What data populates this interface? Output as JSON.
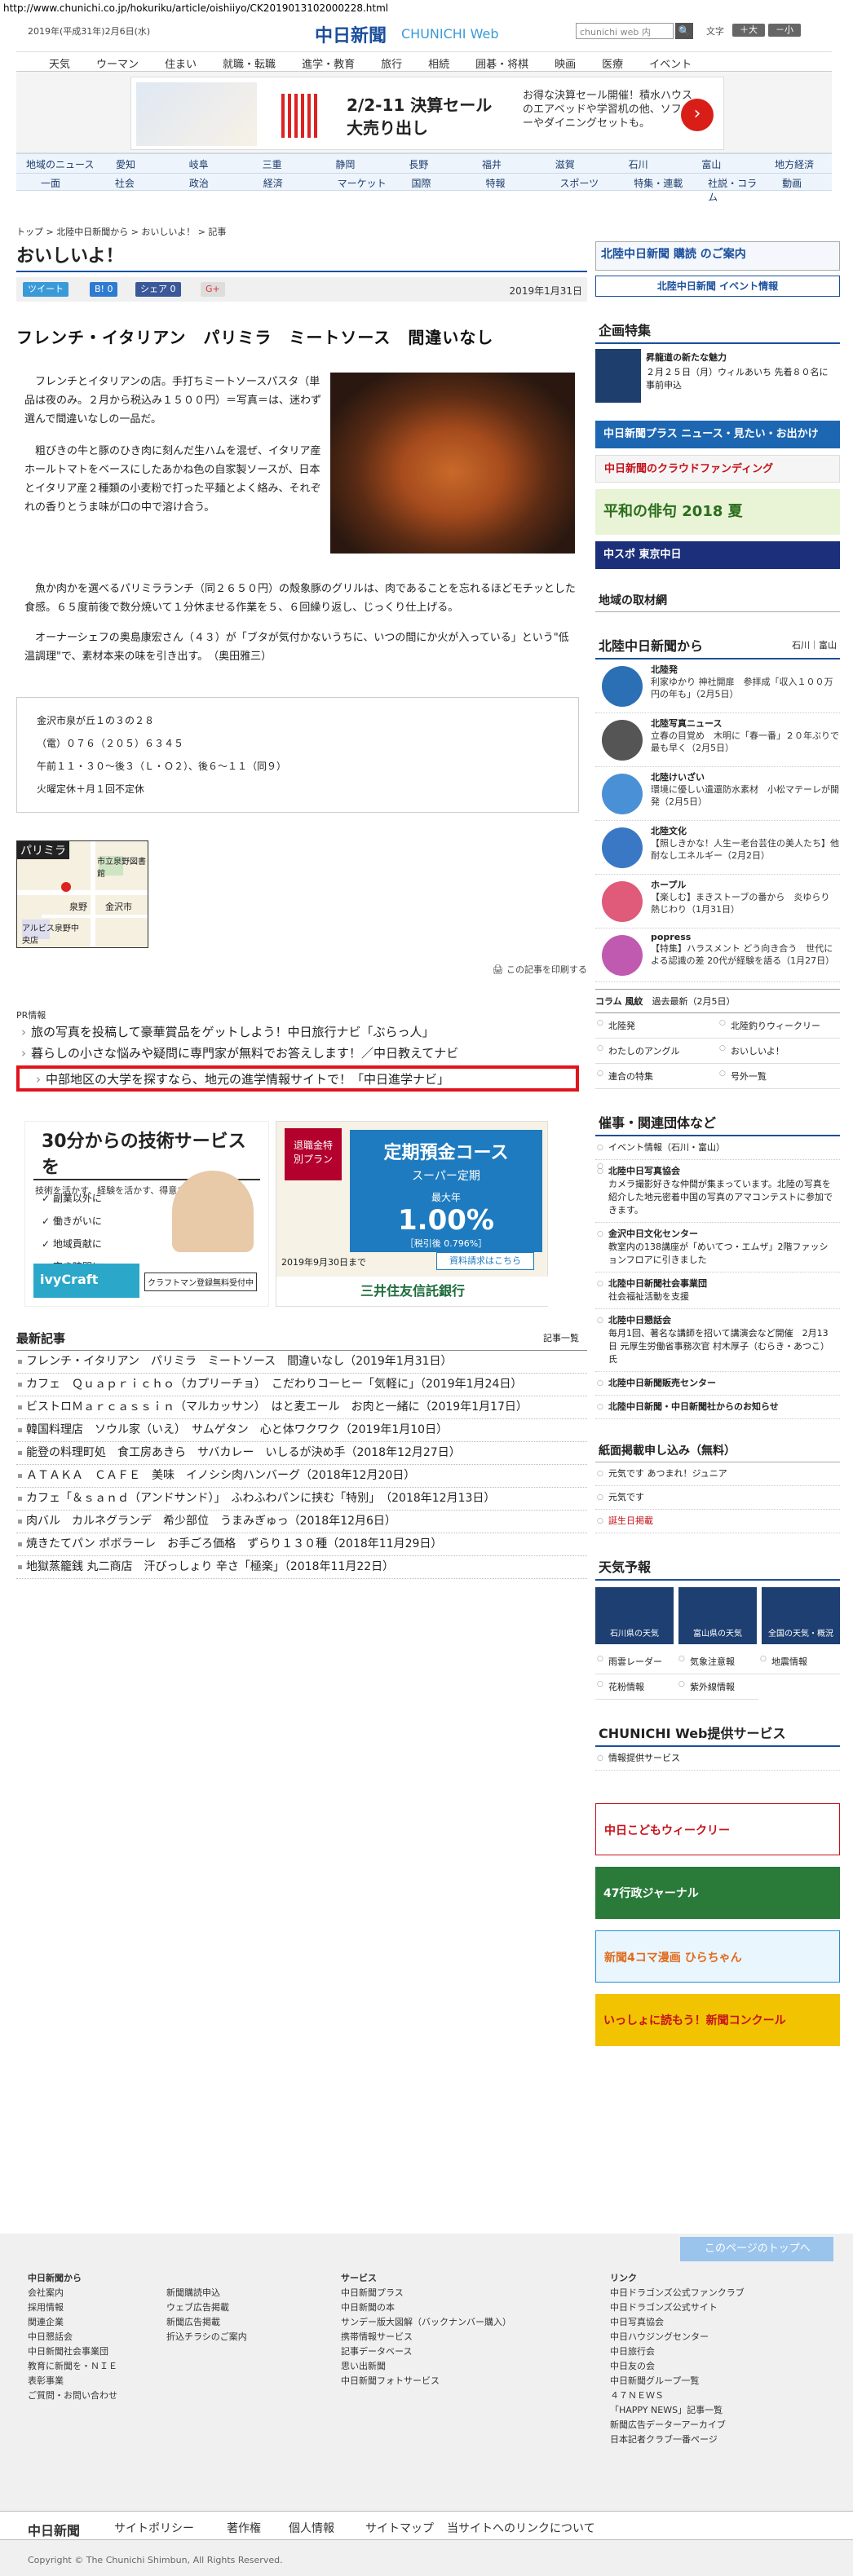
{
  "url": "http://www.chunichi.co.jp/hokuriku/article/oishiiyo/CK2019013102000228.html",
  "header": {
    "date": "2019年(平成31年)2月6日(水)",
    "logo": "中日新聞",
    "logo_sub": "CHUNICHI Web",
    "search_placeholder": "chunichi web 内",
    "search_btn": "🔍",
    "font_label": "文字",
    "font_big": "＋大",
    "font_small": "－小"
  },
  "topnav": [
    "天気",
    "ウーマン",
    "住まい",
    "就職・転職",
    "進学・教育",
    "旅行",
    "相続",
    "囲碁・将棋",
    "映画",
    "医療",
    "イベント"
  ],
  "ad_top": {
    "line1": "2/2-11 決算セール",
    "line2": "大売り出し",
    "desc": "お得な決算セール開催！積水ハウスのエアベッドや学習机の他、ソファーやダイニングセットも。",
    "go": "›"
  },
  "areanav": [
    "地域のニュース",
    "愛知",
    "岐阜",
    "三重",
    "静岡",
    "長野",
    "福井",
    "滋賀",
    "石川",
    "富山",
    "地方経済"
  ],
  "catnav": [
    "一面",
    "社会",
    "政治",
    "経済",
    "マーケット",
    "国際",
    "特報",
    "スポーツ",
    "特集・連載",
    "社説・コラム",
    "動画"
  ],
  "crumb": "トップ > 北陸中日新聞から > おいしいよ！ > 記事",
  "section_title": "おいしいよ！",
  "share": {
    "tweet": "ツイート",
    "hatena": "B! 0",
    "fb": "シェア 0",
    "gplus": "G+",
    "date": "2019年1月31日"
  },
  "article": {
    "headline": "フレンチ・イタリアン　パリミラ　ミートソース　間違いなし",
    "p1": "フレンチとイタリアンの店。手打ちミートソースパスタ（単品は夜のみ。２月から税込み１５００円）＝写真＝は、迷わず選んで間違いなしの一品だ。",
    "p2": "粗びきの牛と豚のひき肉に刻んだ生ハムを混ぜ、イタリア産ホールトマトをベースにしたあかね色の自家製ソースが、日本とイタリア産２種類の小麦粉で打った平麺とよく絡み、それぞれの香りとうま味が口の中で溶け合う。",
    "p3": "魚か肉かを選べるパリミラランチ（同２６５０円）の殻象豚のグリルは、肉であることを忘れるほどモチッとした食感。６５度前後で数分焼いて１分休ませる作業を５、６回繰り返し、じっくり仕上げる。",
    "p4": "オーナーシェフの奥島康宏さん（４３）が「ブタが気付かないうちに、いつの間にか火が入っている」という\"低温調理\"で、素材本来の味を引き出す。　（奥田雅三）"
  },
  "info": {
    "addr": "金沢市泉が丘１の３の２８",
    "tel": "（電）０７６（２０５）６３４５",
    "hours": "午前１１・３０〜後３（Ｌ・Ｏ２）、後６〜１１（同９）",
    "closed": "火曜定休＋月１回不定休"
  },
  "map": {
    "label": "パリミラ",
    "spots": [
      "市立泉野図書館",
      "泉野",
      "金沢市",
      "アルビス泉野中央店"
    ]
  },
  "print_label": "この記事を印刷する",
  "pr": {
    "head": "PR情報",
    "items": [
      "旅の写真を投稿して豪華賞品をゲットしよう！中日旅行ナビ「ぶらっ人」",
      "暮らしの小さな悩みや疑問に専門家が無料でお答えします！／中日教えてナビ",
      "中部地区の大学を探すなら、地元の進学情報サイトで！「中日進学ナビ」"
    ]
  },
  "ad_mid": {
    "a_title": "30分からの技術サービスを",
    "a_sub": "技術を活かす、経験を活かす、得意を活かす",
    "a_points": [
      "副業以外に",
      "働きがいに",
      "地域貢献に",
      "空き時間に"
    ],
    "a_brand": "ivyCraft",
    "a_brand2": "クラフトマン登録無料受付中",
    "b_tag": "退職金特別プラン",
    "b_title": "定期預金コース",
    "b_sub": "スーパー定期",
    "b_rate_label": "最大年",
    "b_rate": "1.00%",
    "b_tax": "［税引後 0.796%］",
    "b_date": "2019年9月30日まで",
    "b_btn": "資料請求はこちら",
    "b_bank": "三井住友信託銀行"
  },
  "latest": {
    "head": "最新記事",
    "more": "記事一覧",
    "items": [
      "フレンチ・イタリアン　パリミラ　ミートソース　間違いなし（2019年1月31日）",
      "カフェ　Ｑｕａｐｒｉｃｈｏ（カプリーチョ）　こだわりコーヒー「気軽に」（2019年1月24日）",
      "ビストロＭａｒｃａｓｓｉｎ（マルカッサン）　はと麦エール　お肉と一緒に（2019年1月17日）",
      "韓国料理店　ソウル家（いえ）　サムゲタン　心と体ワクワク（2019年1月10日）",
      "能登の料理町処　食工房あきら　サバカレー　いしるが決め手（2018年12月27日）",
      "ＡＴＡＫＡ　ＣＡＦＥ　美味　イノシシ肉ハンバーグ（2018年12月20日）",
      "カフェ「＆ｓａｎｄ（アンドサンド）」　ふわふわパンに挟む「特別」　（2018年12月13日）",
      "肉バル　カルネグランデ　希少部位　うまみぎゅっ（2018年12月6日）",
      "焼きたてパン ポボラーレ　お手ごろ価格　ずらり１３０種（2018年11月29日）",
      "地獄蒸籠銭 丸二商店　汗びっしょり 辛さ「極楽」（2018年11月22日）"
    ]
  },
  "side": {
    "subscribe": "北陸中日新聞 購読 のご案内",
    "events": "北陸中日新聞 イベント情報",
    "kikaku_head": "企画特集",
    "kikaku_title": "昇龍道の新たな魅力",
    "kikaku_text": "２月２５日（月）ウィルあいち 先着８０名に事前申込",
    "banners": [
      "中日新聞プラス ニュース・見たい・お出かけ",
      "中日新聞のクラウドファンディング",
      "平和の俳句 2018 夏",
      "中スポ 東京中日"
    ],
    "area_head": "地域の取材網",
    "hokuriku_head": "北陸中日新聞から",
    "hokuriku_links": "石川｜富山",
    "news": [
      {
        "t": "北陸発",
        "d": "利家ゆかり 神社開扉　参拝成「収入１００万円の年も」（2月5日）",
        "c": "#2b6fb5"
      },
      {
        "t": "北陸写真ニュース",
        "d": "立春の目覚め　木明に「春一番」２０年ぶりで最も早く（2月5日）",
        "c": "#555"
      },
      {
        "t": "北陸けいざい",
        "d": "環境に優しい遺還防水素材　小松マテーレが開発（2月5日）",
        "c": "#4a90d6"
      },
      {
        "t": "北陸文化",
        "d": "【照しきかな！人生ー老台芸住の美人たち】他耐なしエネルギー（2月2日）",
        "c": "#3a78c6"
      },
      {
        "t": "ホープル",
        "d": "【楽しむ】まきストーブの番から　炎ゆらり 熱じわり（1月31日）",
        "c": "#e05a7a"
      },
      {
        "t": "popress",
        "d": "【特集】ハラスメント どう向き合う　世代による認識の差 20代が経験を語る（1月27日）",
        "c": "#c05ab0"
      }
    ],
    "column_head": "コラム 風紋",
    "column_link": "過去最新（2月5日）",
    "grid": [
      "北陸発",
      "北陸釣りウィークリー",
      "わたしのアングル",
      "おいしいよ！",
      "連合の特集",
      "号外一覧"
    ],
    "sponsor_head": "催事・関連団体など",
    "event_info": "イベント情報（石川・富山）",
    "sponsors": [
      {
        "t": "北陸中日写真協会",
        "d": "カメラ撮影好きな仲間が集まっています。北陸の写真を紹介した地元密着中国の写真のアマコンテストに参加できます。"
      },
      {
        "t": "金沢中日文化センター",
        "d": "教室内の138講座が「めいてつ・エムザ」2階ファッションフロアに引きました"
      },
      {
        "t": "北陸中日新聞社会事業団",
        "d": "社会福祉活動を支援"
      },
      {
        "t": "北陸中日懇話会",
        "d": "毎月1回、著名な講師を招いて講演会など開催　2月13日 元厚生労働省事務次官 村木厚子（むらき・あつこ）氏"
      },
      {
        "t": "北陸中日新聞販売センター",
        "d": ""
      },
      {
        "t": "北陸中日新聞・中日新聞社からのお知らせ",
        "d": ""
      }
    ],
    "paper_head": "紙面掲載申し込み（無料）",
    "paper_items": [
      "元気です あつまれ！ジュニア",
      "元気です",
      "誕生日掲載"
    ],
    "weather_head": "天気予報",
    "weather": [
      "石川県の天気",
      "富山県の天気",
      "全国の天気・概況"
    ],
    "weather_links": [
      "雨雲レーダー",
      "気象注意報",
      "地震情報",
      "花粉情報",
      "紫外線情報"
    ],
    "service_head": "CHUNICHI Web提供サービス",
    "service_link": "情報提供サービス",
    "b2": [
      "中日こどもウィークリー",
      "47行政ジャーナル",
      "新聞4コマ漫画 ひらちゃん",
      "いっしょに読もう！新聞コンクール"
    ]
  },
  "footer": {
    "top": "このページのトップへ",
    "col1_head": "中日新聞から",
    "col1": [
      "会社案内",
      "採用情報",
      "関連企業",
      "中日懇話会",
      "中日新聞社会事業団",
      "教育に新聞を・ＮＩＥ",
      "表彰事業",
      "ご質問・お問い合わせ"
    ],
    "col2": [
      "新聞購読申込",
      "ウェブ広告掲載",
      "新聞広告掲載",
      "折込チラシのご案内"
    ],
    "col3_head": "サービス",
    "col3": [
      "中日新聞プラス",
      "中日新聞の本",
      "サンデー版大図解（バックナンバー購入）",
      "携帯情報サービス",
      "記事データベース",
      "思い出新聞",
      "中日新聞フォトサービス"
    ],
    "col4_head": "リンク",
    "col4": [
      "中日ドラゴンズ公式ファンクラブ",
      "中日ドラゴンズ公式サイト",
      "中日写真協会",
      "中日ハウジングセンター",
      "中日旅行会",
      "中日友の会",
      "中日新聞グループ一覧",
      "４７ＮＥＷＳ",
      "「HAPPY NEWS」記事一覧",
      "新聞広告データーアーカイブ",
      "日本記者クラブ一番ページ"
    ],
    "bar": [
      "中日新聞",
      "サイトポリシー",
      "著作権",
      "個人情報",
      "サイトマップ",
      "当サイトへのリンクについて"
    ],
    "copy": "Copyright © The Chunichi Shimbun, All Rights Reserved."
  }
}
